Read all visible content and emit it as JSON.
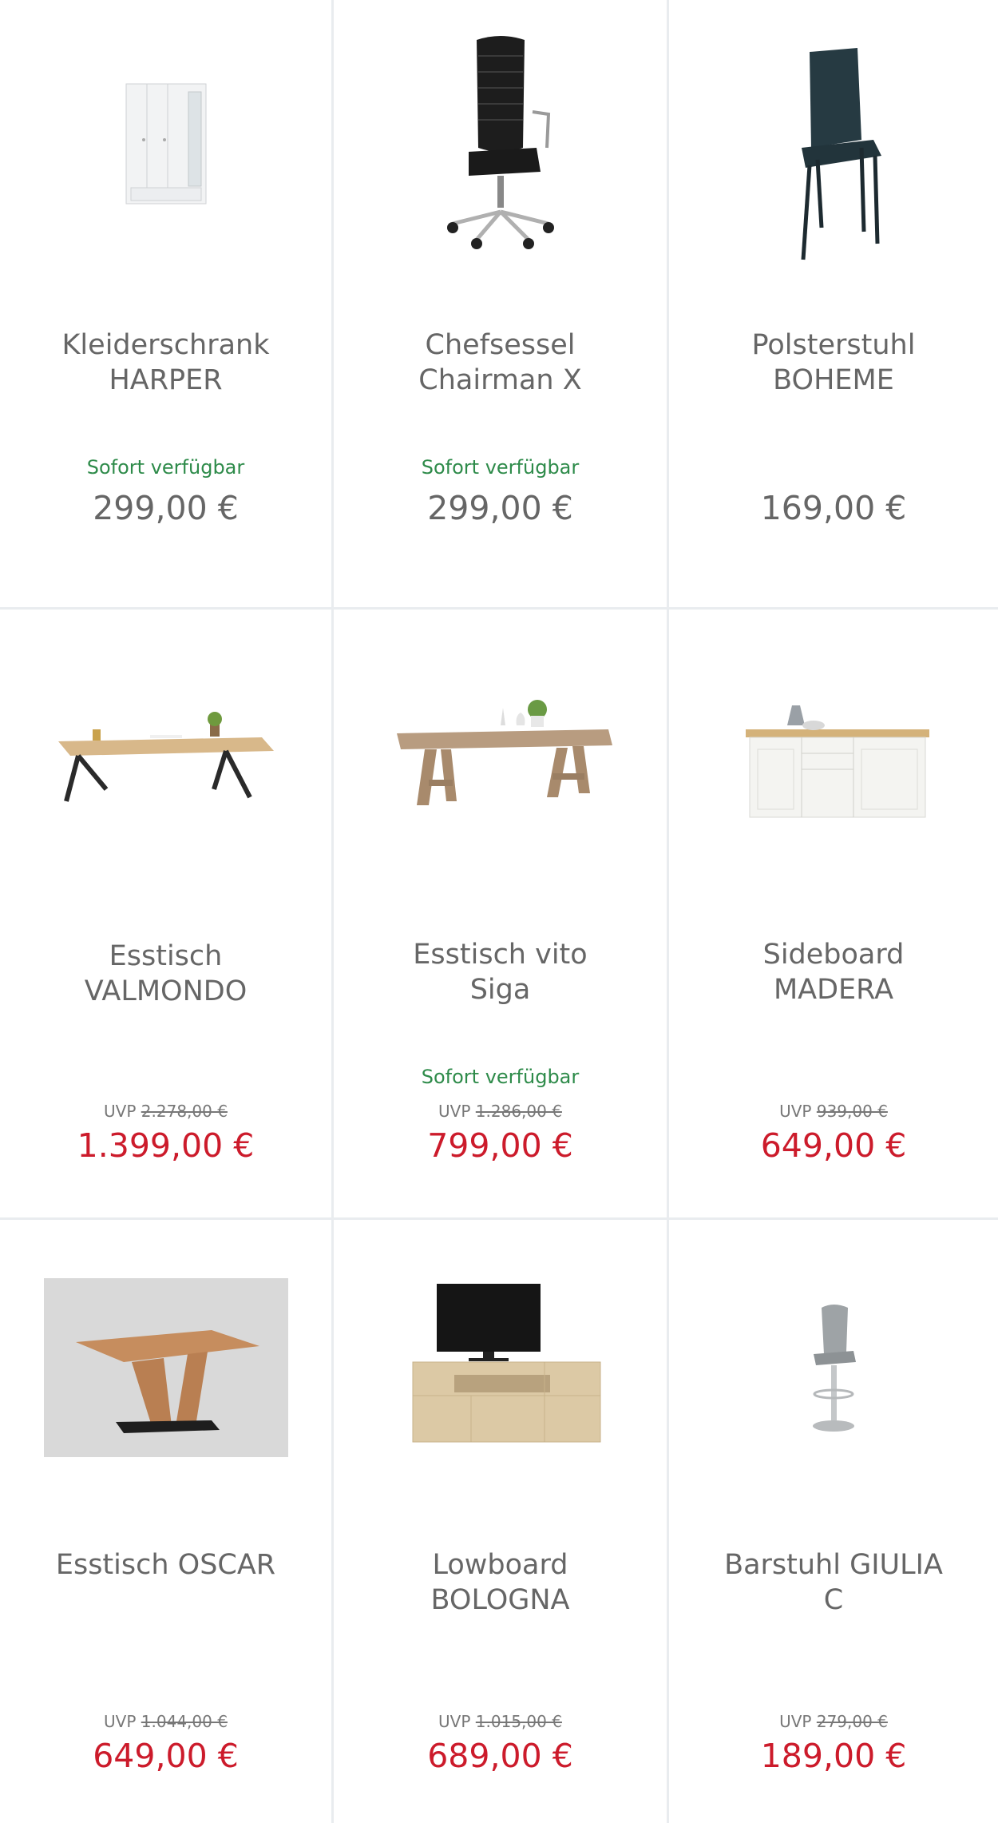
{
  "products": [
    {
      "title_line1": "Kleiderschrank",
      "title_line2": "HARPER",
      "stock": "Sofort verfügbar",
      "uvp_label": "",
      "uvp_value": "",
      "price": "299,00 €",
      "sale": false,
      "image": "wardrobe-image"
    },
    {
      "title_line1": "Chefsessel",
      "title_line2": "Chairman X",
      "stock": "Sofort verfügbar",
      "uvp_label": "",
      "uvp_value": "",
      "price": "299,00 €",
      "sale": false,
      "image": "office-chair-image"
    },
    {
      "title_line1": "Polsterstuhl",
      "title_line2": "BOHEME",
      "stock": "",
      "uvp_label": "",
      "uvp_value": "",
      "price": "169,00 €",
      "sale": false,
      "image": "dining-chair-image"
    },
    {
      "title_line1": "Esstisch",
      "title_line2": "VALMONDO",
      "stock": "",
      "uvp_label": "UVP",
      "uvp_value": "2.278,00 €",
      "price": "1.399,00 €",
      "sale": true,
      "image": "dining-table-image"
    },
    {
      "title_line1": "Esstisch vito",
      "title_line2": "Siga",
      "stock": "Sofort verfügbar",
      "uvp_label": "UVP",
      "uvp_value": "1.286,00 €",
      "price": "799,00 €",
      "sale": true,
      "image": "wooden-table-image"
    },
    {
      "title_line1": "Sideboard",
      "title_line2": "MADERA",
      "stock": "",
      "uvp_label": "UVP",
      "uvp_value": "939,00 €",
      "price": "649,00 €",
      "sale": true,
      "image": "sideboard-image"
    },
    {
      "title_line1": "Esstisch OSCAR",
      "title_line2": "",
      "stock": "",
      "uvp_label": "UVP",
      "uvp_value": "1.044,00 €",
      "price": "649,00 €",
      "sale": true,
      "image": "table-oscar-image"
    },
    {
      "title_line1": "Lowboard",
      "title_line2": "BOLOGNA",
      "stock": "",
      "uvp_label": "UVP",
      "uvp_value": "1.015,00 €",
      "price": "689,00 €",
      "sale": true,
      "image": "lowboard-image"
    },
    {
      "title_line1": "Barstuhl GIULIA",
      "title_line2": "C",
      "stock": "",
      "uvp_label": "UVP",
      "uvp_value": "279,00 €",
      "price": "189,00 €",
      "sale": true,
      "image": "barstool-image"
    }
  ],
  "colors": {
    "sale_price": "#cc1b2b",
    "regular_price": "#666666",
    "stock": "#2e8b4a",
    "divider": "#e9ecef"
  }
}
